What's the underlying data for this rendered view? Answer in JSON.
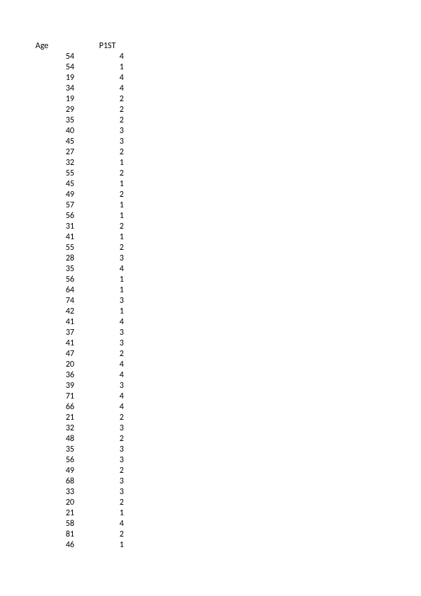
{
  "headers": {
    "col1": "Age",
    "col2": "P1ST"
  },
  "rows": [
    {
      "age": "54",
      "p1st": "4"
    },
    {
      "age": "54",
      "p1st": "1"
    },
    {
      "age": "19",
      "p1st": "4"
    },
    {
      "age": "34",
      "p1st": "4"
    },
    {
      "age": "19",
      "p1st": "2"
    },
    {
      "age": "29",
      "p1st": "2"
    },
    {
      "age": "35",
      "p1st": "2"
    },
    {
      "age": "40",
      "p1st": "3"
    },
    {
      "age": "45",
      "p1st": "3"
    },
    {
      "age": "27",
      "p1st": "2"
    },
    {
      "age": "32",
      "p1st": "1"
    },
    {
      "age": "55",
      "p1st": "2"
    },
    {
      "age": "45",
      "p1st": "1"
    },
    {
      "age": "49",
      "p1st": "2"
    },
    {
      "age": "57",
      "p1st": "1"
    },
    {
      "age": "56",
      "p1st": "1"
    },
    {
      "age": "31",
      "p1st": "2"
    },
    {
      "age": "41",
      "p1st": "1"
    },
    {
      "age": "55",
      "p1st": "2"
    },
    {
      "age": "28",
      "p1st": "3"
    },
    {
      "age": "35",
      "p1st": "4"
    },
    {
      "age": "56",
      "p1st": "1"
    },
    {
      "age": "64",
      "p1st": "1"
    },
    {
      "age": "74",
      "p1st": "3"
    },
    {
      "age": "42",
      "p1st": "1"
    },
    {
      "age": "41",
      "p1st": "4"
    },
    {
      "age": "37",
      "p1st": "3"
    },
    {
      "age": "41",
      "p1st": "3"
    },
    {
      "age": "47",
      "p1st": "2"
    },
    {
      "age": "20",
      "p1st": "4"
    },
    {
      "age": "36",
      "p1st": "4"
    },
    {
      "age": "39",
      "p1st": "3"
    },
    {
      "age": "71",
      "p1st": "4"
    },
    {
      "age": "66",
      "p1st": "4"
    },
    {
      "age": "21",
      "p1st": "2"
    },
    {
      "age": "32",
      "p1st": "3"
    },
    {
      "age": "48",
      "p1st": "2"
    },
    {
      "age": "35",
      "p1st": "3"
    },
    {
      "age": "56",
      "p1st": "3"
    },
    {
      "age": "49",
      "p1st": "2"
    },
    {
      "age": "68",
      "p1st": "3"
    },
    {
      "age": "33",
      "p1st": "3"
    },
    {
      "age": "20",
      "p1st": "2"
    },
    {
      "age": "21",
      "p1st": "1"
    },
    {
      "age": "58",
      "p1st": "4"
    },
    {
      "age": "81",
      "p1st": "2"
    },
    {
      "age": "46",
      "p1st": "1"
    }
  ]
}
